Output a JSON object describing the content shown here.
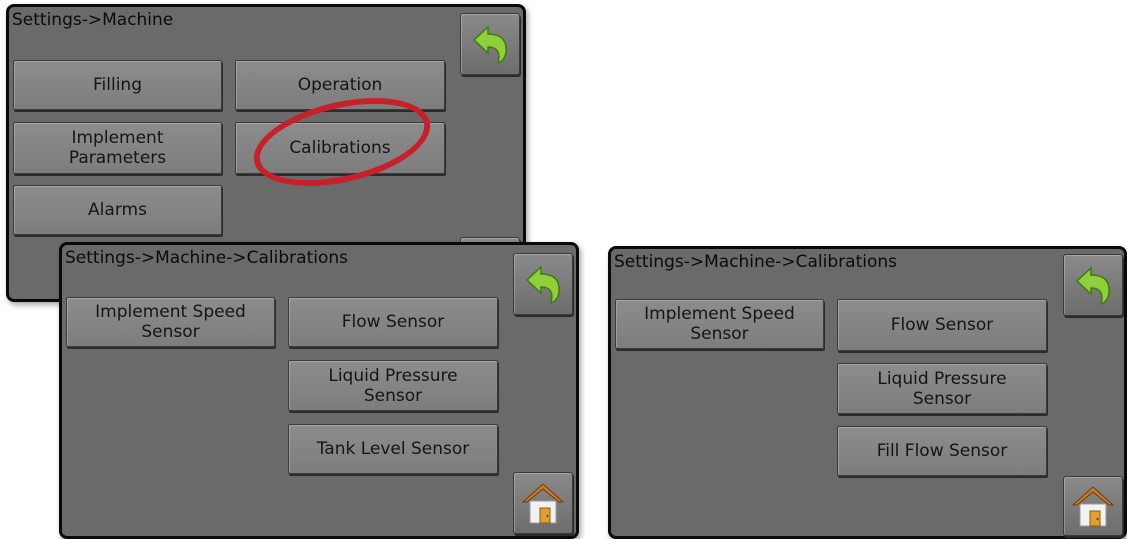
{
  "screens": [
    {
      "title": "Settings->Machine",
      "buttons": [
        "Filling",
        "Operation",
        "Implement\nParameters",
        "Calibrations",
        "Alarms"
      ],
      "back_icon": "back-arrow-icon"
    },
    {
      "title": "Settings->Machine->Calibrations",
      "buttons": [
        "Implement Speed\nSensor",
        "Flow Sensor",
        "Liquid Pressure\nSensor",
        "Tank Level Sensor"
      ],
      "back_icon": "back-arrow-icon",
      "home_icon": "home-icon"
    },
    {
      "title": "Settings->Machine->Calibrations",
      "buttons": [
        "Implement Speed\nSensor",
        "Flow Sensor",
        "Liquid Pressure\nSensor",
        "Fill Flow Sensor"
      ],
      "back_icon": "back-arrow-icon",
      "home_icon": "home-icon"
    }
  ],
  "highlight": {
    "target": "Calibrations",
    "color": "#c8202a"
  },
  "colors": {
    "screen_background": "#6a6a6a",
    "button_face": "#858585",
    "back_arrow": "#8fcf3a",
    "home_roof": "#c87c2a"
  }
}
